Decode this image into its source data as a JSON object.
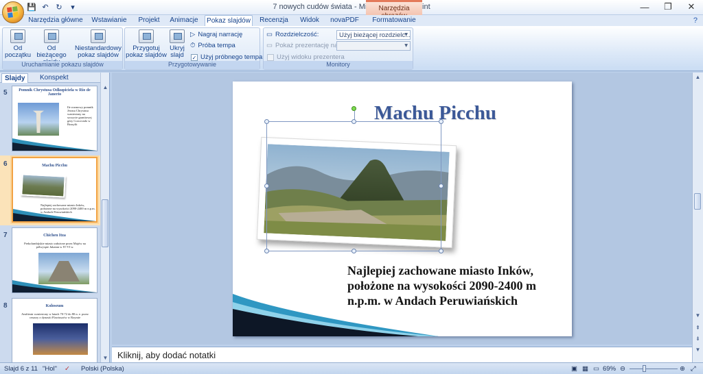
{
  "window": {
    "title": "7 nowych cudów świata - Microsoft PowerPoint",
    "context_tab_group": "Narzędzia obrazów",
    "controls": [
      "—",
      "❐",
      "✕"
    ]
  },
  "ribbon_tabs": [
    {
      "label": "Narzędzia główne"
    },
    {
      "label": "Wstawianie"
    },
    {
      "label": "Projekt"
    },
    {
      "label": "Animacje"
    },
    {
      "label": "Pokaz slajdów"
    },
    {
      "label": "Recenzja"
    },
    {
      "label": "Widok"
    },
    {
      "label": "novaPDF"
    },
    {
      "label": "Formatowanie"
    }
  ],
  "ribbon": {
    "group_start": {
      "label": "Uruchamianie pokazu slajdów",
      "from_beginning": "Od początku",
      "from_current": "Od bieżącego slajdu",
      "custom": "Niestandardowy pokaz slajdów"
    },
    "group_setup": {
      "label": "Przygotowywanie",
      "setup_show": "Przygotuj pokaz slajdów",
      "hide_slide": "Ukryj slajd",
      "record": "Nagraj narrację",
      "rehearse": "Próba tempa",
      "use_timings": "Użyj próbnego tempa",
      "use_timings_checked": "✓"
    },
    "group_monitors": {
      "label": "Monitory",
      "resolution_label": "Rozdzielczość:",
      "resolution_value": "Użyj bieżącej rozdzielc...",
      "show_on_label": "Pokaż prezentację na:",
      "show_on_value": "",
      "presenter_view": "Użyj widoku prezentera"
    }
  },
  "side_panel": {
    "tab_slides": "Slajdy",
    "tab_outline": "Konspekt",
    "close": "×",
    "thumbnails": [
      {
        "num": "5",
        "title": "Pomnik Chrystusa Odkupiciela w Rio de Janerio",
        "text": "Ile rozmowy pomnik Jezusa Chrystusa wzniesiony na szczycie granitowej góry Corcovado w Brazylii"
      },
      {
        "num": "6",
        "title": "Machu Picchu",
        "text": "Najlepiej zachowane miasto Inków, położone na wysokości 2090-2400 m n.p.m. w Andach Peruwiańskich"
      },
      {
        "num": "7",
        "title": "Chichen Itza",
        "text": "Prekolumbijskie miasto założone przez Majów na półwyspie Jukatan w IV-VI w."
      },
      {
        "num": "8",
        "title": "Koloseum",
        "text": "Amfiteatr wzniesiony w latach 70-72 do 80 n. e. przez cesarzy z dynastii Flawiuszów w Rzymie"
      }
    ]
  },
  "slide": {
    "title": "Machu Picchu",
    "body": "Najlepiej zachowane miasto Inków, położone na wysokości 2090-2400 m n.p.m. w Andach Peruwiańskich"
  },
  "notes_placeholder": "Kliknij, aby dodać notatki",
  "status": {
    "slide_counter": "Slajd 6 z 11",
    "theme": "\"Hol\"",
    "language": "Polski (Polska)",
    "zoom": "69%"
  },
  "colors": {
    "accent": "#3c5998",
    "context_tab": "#e47a5a",
    "selection": "#f2a344"
  }
}
